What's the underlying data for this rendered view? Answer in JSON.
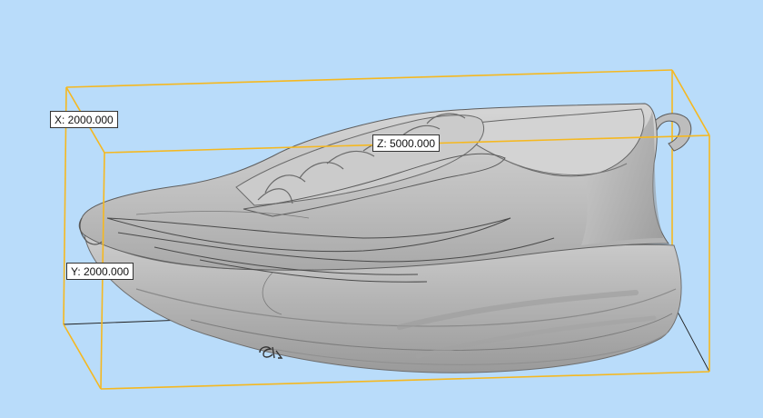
{
  "viewport": {
    "background_color": "#b9dcfa",
    "bounding_box_color": "#f5b820",
    "model_color": "#c9c9c9",
    "model": "sneaker-3d-model"
  },
  "dimensions": {
    "x_label": "X: 2000.000",
    "z_label": "Z: 5000.000",
    "y_label": "Y: 2000.000"
  }
}
